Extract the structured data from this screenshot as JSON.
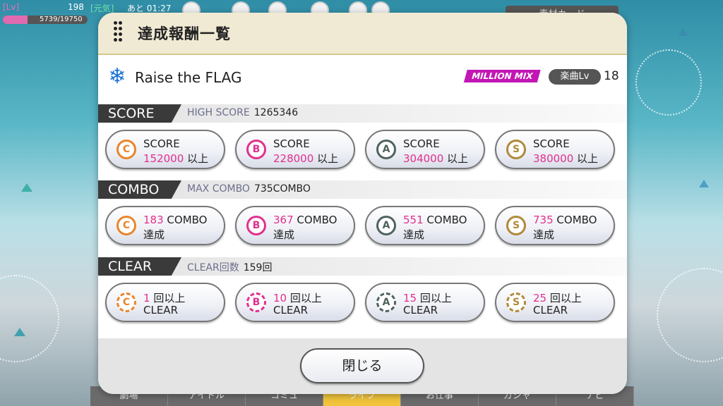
{
  "status": {
    "lv_tag": "[Lv]",
    "level": "198",
    "genki_tag": "[元気]",
    "time_left": "あと 01:27",
    "exp_text": "5739/19750",
    "exp_progress": 0.29,
    "top_right_button": "素材カード"
  },
  "bottom_nav": [
    "劇場",
    "アイドル",
    "コミュ",
    "ライブ",
    "お仕事",
    "ガシャ",
    "ナビ"
  ],
  "modal": {
    "title": "達成報酬一覧",
    "song_title": "Raise the FLAG",
    "mix_badge": "MILLION MIX",
    "level_label": "楽曲Lv",
    "level_value": "18",
    "close_label": "閉じる"
  },
  "sections": [
    {
      "label": "SCORE",
      "sub_label": "HIGH SCORE",
      "sub_value": "1265346",
      "rewards": [
        {
          "rank": "C",
          "top": "SCORE",
          "value": "152000",
          "suffix": "以上"
        },
        {
          "rank": "B",
          "top": "SCORE",
          "value": "228000",
          "suffix": "以上"
        },
        {
          "rank": "A",
          "top": "SCORE",
          "value": "304000",
          "suffix": "以上"
        },
        {
          "rank": "S",
          "top": "SCORE",
          "value": "380000",
          "suffix": "以上"
        }
      ]
    },
    {
      "label": "COMBO",
      "sub_label": "MAX COMBO",
      "sub_value": "735COMBO",
      "rewards": [
        {
          "rank": "C",
          "value": "183",
          "top": "COMBO",
          "bottom": "達成"
        },
        {
          "rank": "B",
          "value": "367",
          "top": "COMBO",
          "bottom": "達成"
        },
        {
          "rank": "A",
          "value": "551",
          "top": "COMBO",
          "bottom": "達成"
        },
        {
          "rank": "S",
          "value": "735",
          "top": "COMBO",
          "bottom": "達成"
        }
      ]
    },
    {
      "label": "CLEAR",
      "sub_label": "CLEAR回数",
      "sub_value": "159回",
      "rewards": [
        {
          "rank": "C",
          "value": "1",
          "top": "回以上",
          "bottom": "CLEAR"
        },
        {
          "rank": "B",
          "value": "10",
          "top": "回以上",
          "bottom": "CLEAR"
        },
        {
          "rank": "A",
          "value": "15",
          "top": "回以上",
          "bottom": "CLEAR"
        },
        {
          "rank": "S",
          "value": "25",
          "top": "回以上",
          "bottom": "CLEAR"
        }
      ]
    }
  ],
  "colors": {
    "rank_C": "#e9852b",
    "rank_B": "#e2308f",
    "rank_A": "#4f6360",
    "rank_S": "#b08a3a",
    "accent_pink": "#e2308f",
    "header_gold": "#d8c787"
  }
}
